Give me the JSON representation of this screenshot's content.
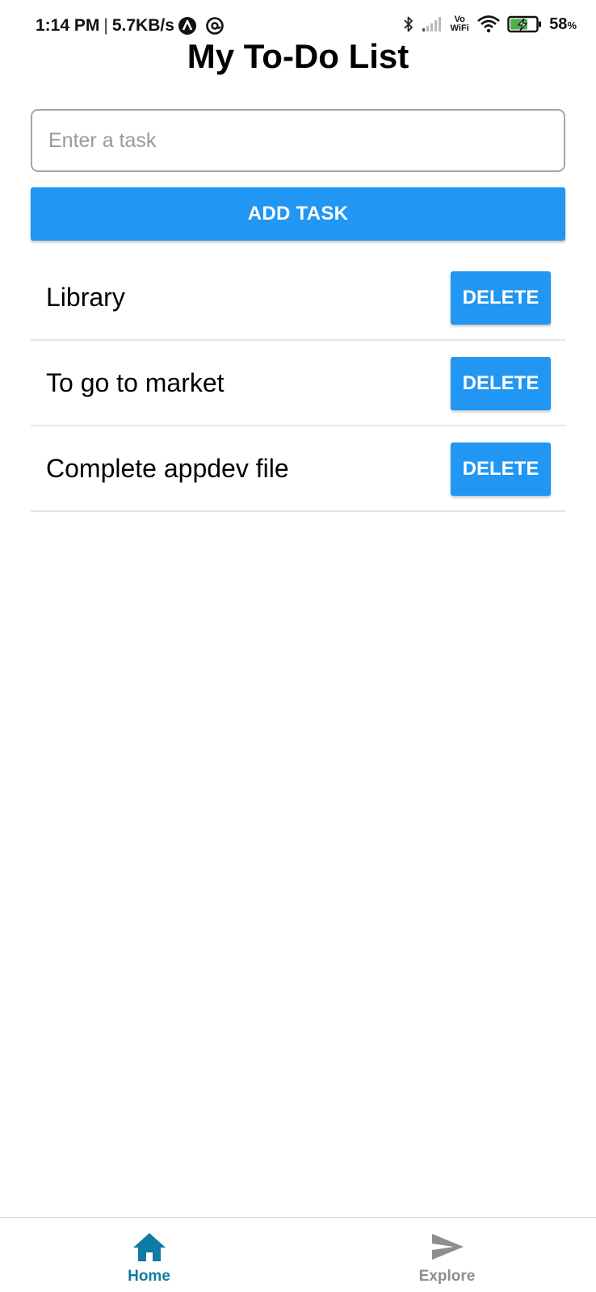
{
  "status_bar": {
    "time": "1:14 PM",
    "separator": "|",
    "network_speed": "5.7KB/s",
    "vowifi_top": "Vo",
    "vowifi_bottom": "WiFi",
    "battery_percent": "58",
    "battery_unit": "%",
    "icons": [
      "app-notification-icon",
      "at-sign-icon",
      "bluetooth-icon",
      "signal-icon",
      "wifi-icon",
      "battery-charging-icon"
    ]
  },
  "header": {
    "title": "My To-Do List"
  },
  "task_form": {
    "input_value": "",
    "input_placeholder": "Enter a task",
    "add_button_label": "ADD TASK"
  },
  "tasks": [
    {
      "label": "Library",
      "delete_label": "DELETE"
    },
    {
      "label": "To go to market",
      "delete_label": "DELETE"
    },
    {
      "label": "Complete appdev file",
      "delete_label": "DELETE"
    }
  ],
  "tab_bar": {
    "tabs": [
      {
        "label": "Home",
        "icon": "home-icon",
        "active": true
      },
      {
        "label": "Explore",
        "icon": "send-icon",
        "active": false
      }
    ]
  },
  "colors": {
    "primary": "#2196f3",
    "active_tab": "#0f7ca6",
    "inactive_tab": "#8e8e8e",
    "divider": "#e6e6e6"
  }
}
